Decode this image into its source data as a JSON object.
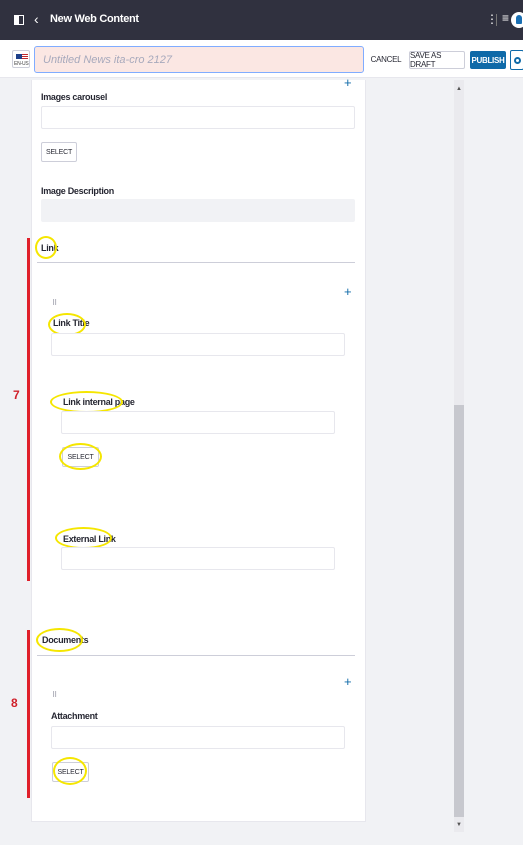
{
  "header": {
    "title": "New Web Content"
  },
  "toolbar": {
    "locale_label": "EN-US",
    "title_placeholder": "Untitled News ita-cro 2127",
    "cancel_label": "CANCEL",
    "draft_label": "SAVE AS DRAFT",
    "publish_label": "PUBLISH"
  },
  "form": {
    "images_carousel_label": "Images carousel",
    "images_select_label": "SELECT",
    "image_description_label": "Image Description",
    "link_section_label": "Link",
    "link_title_label": "Link Title",
    "link_internal_page_label": "Link internal page",
    "link_internal_select_label": "SELECT",
    "external_link_label": "External Link",
    "documents_section_label": "Documents",
    "attachment_label": "Attachment",
    "attachment_select_label": "SELECT"
  },
  "annotations": {
    "section_7": "7",
    "section_8": "8",
    "highlight_color": "#f5e600",
    "bracket_color": "#e0202a"
  },
  "icons": {
    "sidebar": "sidebar-toggle-icon",
    "back": "chevron-left-icon",
    "kebab": "kebab-icon",
    "menu": "hamburger-icon",
    "avatar": "user-avatar-icon",
    "settings": "gear-icon",
    "add": "plus-icon",
    "drag": "drag-handle-icon"
  }
}
